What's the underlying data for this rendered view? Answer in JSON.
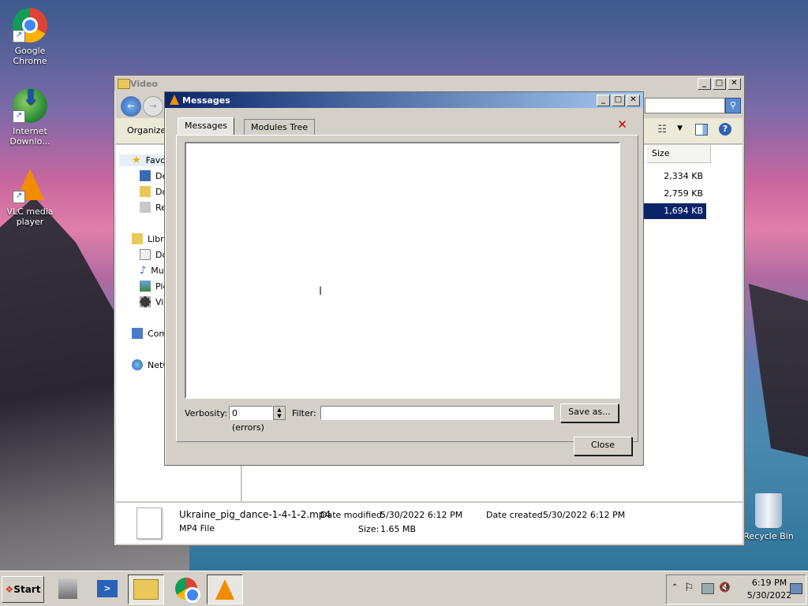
{
  "desktop": {
    "icons": [
      {
        "label": "Google Chrome",
        "icon": "chrome-icon"
      },
      {
        "label": "Internet Downlo...",
        "icon": "internet-download-manager-icon"
      },
      {
        "label": "VLC media player",
        "icon": "vlc-icon"
      },
      {
        "label": "Recycle Bin",
        "icon": "recycle-bin-icon"
      }
    ]
  },
  "explorer": {
    "title": "Video",
    "toolbar": {
      "organize": "Organize"
    },
    "nav": [
      "Favo",
      "De",
      "Do",
      "Re",
      "Libra",
      "Do",
      "Mu",
      "Pic",
      "Vid",
      "Com",
      "Netw"
    ],
    "column_size": "Size",
    "sizes": [
      "2,334 KB",
      "2,759 KB",
      "1,694 KB"
    ],
    "details": {
      "filename": "Ukraine_pig_dance-1-4-1-2.mp4",
      "filetype": "MP4 File",
      "date_modified_label": "Date modified:",
      "date_modified": "5/30/2022 6:12 PM",
      "size_label": "Size:",
      "size": "1.65 MB",
      "date_created_label": "Date created:",
      "date_created": "5/30/2022 6:12 PM"
    }
  },
  "messages": {
    "title": "Messages",
    "tabs": [
      "Messages",
      "Modules Tree"
    ],
    "verbosity_label": "Verbosity:",
    "verbosity_value": "0 (errors)",
    "filter_label": "Filter:",
    "filter_value": "",
    "save_as": "Save as...",
    "close": "Close"
  },
  "taskbar": {
    "start": "Start",
    "time": "6:19 PM",
    "date": "5/30/2022"
  },
  "colors": {
    "accent": "#0a246a",
    "vlc": "#f28c00",
    "close_x": "#cc0000"
  }
}
